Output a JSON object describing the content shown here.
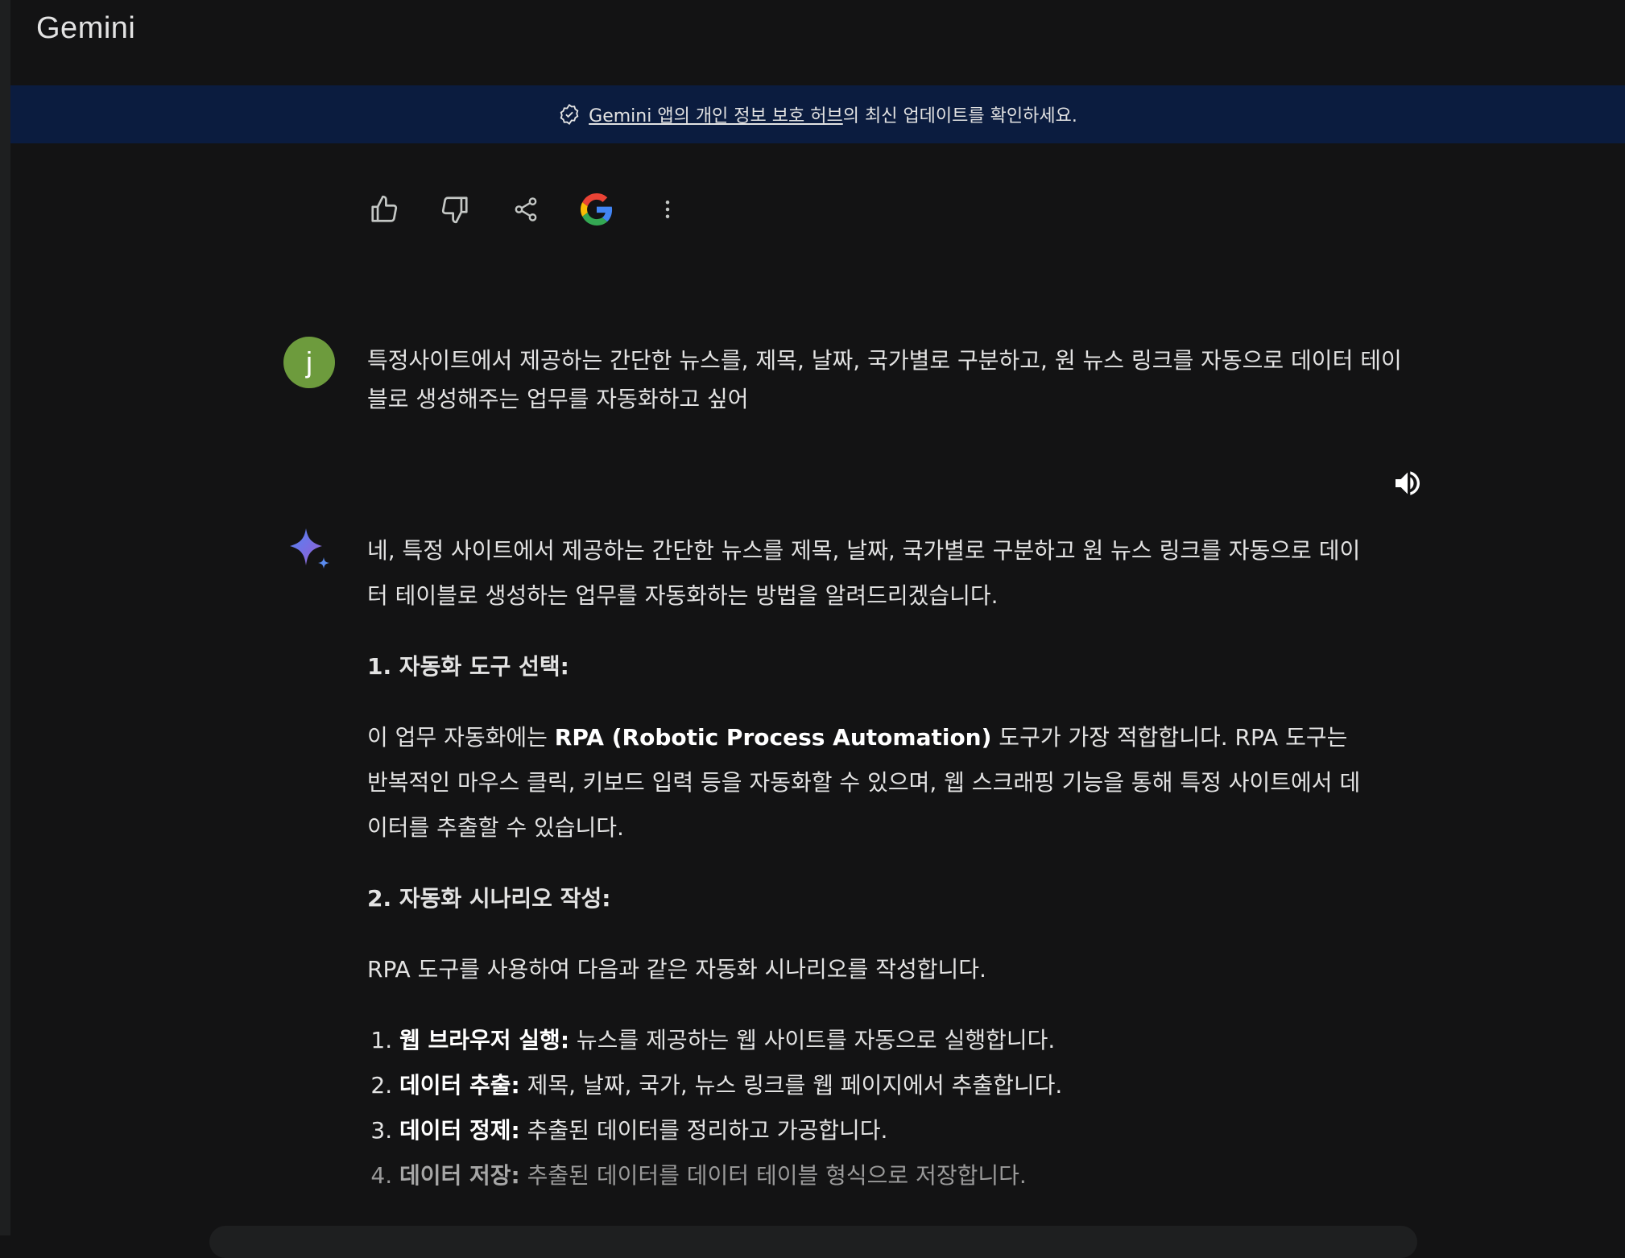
{
  "app": {
    "title": "Gemini"
  },
  "banner": {
    "link_text": "Gemini 앱의 개인 정보 보호 허브 ",
    "suffix_text": "의 최신 업데이트를 확인하세요."
  },
  "actions": {
    "icons": [
      "thumbs-up-icon",
      "thumbs-down-icon",
      "share-icon",
      "google-icon",
      "more-vert-icon"
    ]
  },
  "user": {
    "avatar_letter": "j",
    "message": "특정사이트에서 제공하는 간단한 뉴스를, 제목, 날짜, 국가별로 구분하고, 원 뉴스 링크를 자동으로 데이터 테이블로 생성해주는 업무를 자동화하고 싶어"
  },
  "response": {
    "intro": "네, 특정 사이트에서 제공하는 간단한 뉴스를 제목, 날짜, 국가별로 구분하고 원 뉴스 링크를 자동으로 데이터 테이블로 생성하는 업무를 자동화하는 방법을 알려드리겠습니다.",
    "section1": {
      "heading": "1. 자동화 도구 선택:",
      "text_before": "이 업무 자동화에는 ",
      "bold": "RPA (Robotic Process Automation)",
      "text_after": " 도구가 가장 적합합니다. RPA 도구는 반복적인 마우스 클릭, 키보드 입력 등을 자동화할 수 있으며, 웹 스크래핑 기능을 통해 특정 사이트에서 데이터를 추출할 수 있습니다."
    },
    "section2": {
      "heading": "2. 자동화 시나리오 작성:",
      "text": "RPA 도구를 사용하여 다음과 같은 자동화 시나리오를 작성합니다."
    },
    "steps": [
      {
        "bold": "웹 브라우저 실행:",
        "text": " 뉴스를 제공하는 웹 사이트를 자동으로 실행합니다."
      },
      {
        "bold": "데이터 추출:",
        "text": " 제목, 날짜, 국가, 뉴스 링크를 웹 페이지에서 추출합니다."
      },
      {
        "bold": "데이터 정제:",
        "text": " 추출된 데이터를 정리하고 가공합니다."
      },
      {
        "bold": "데이터 저장:",
        "text": " 추출된 데이터를 데이터 테이블 형식으로 저장합니다."
      }
    ]
  },
  "colors": {
    "background": "#131314",
    "banner": "#0b1c3f",
    "avatar": "#6d9b3d",
    "text": "#e3e3e3"
  }
}
